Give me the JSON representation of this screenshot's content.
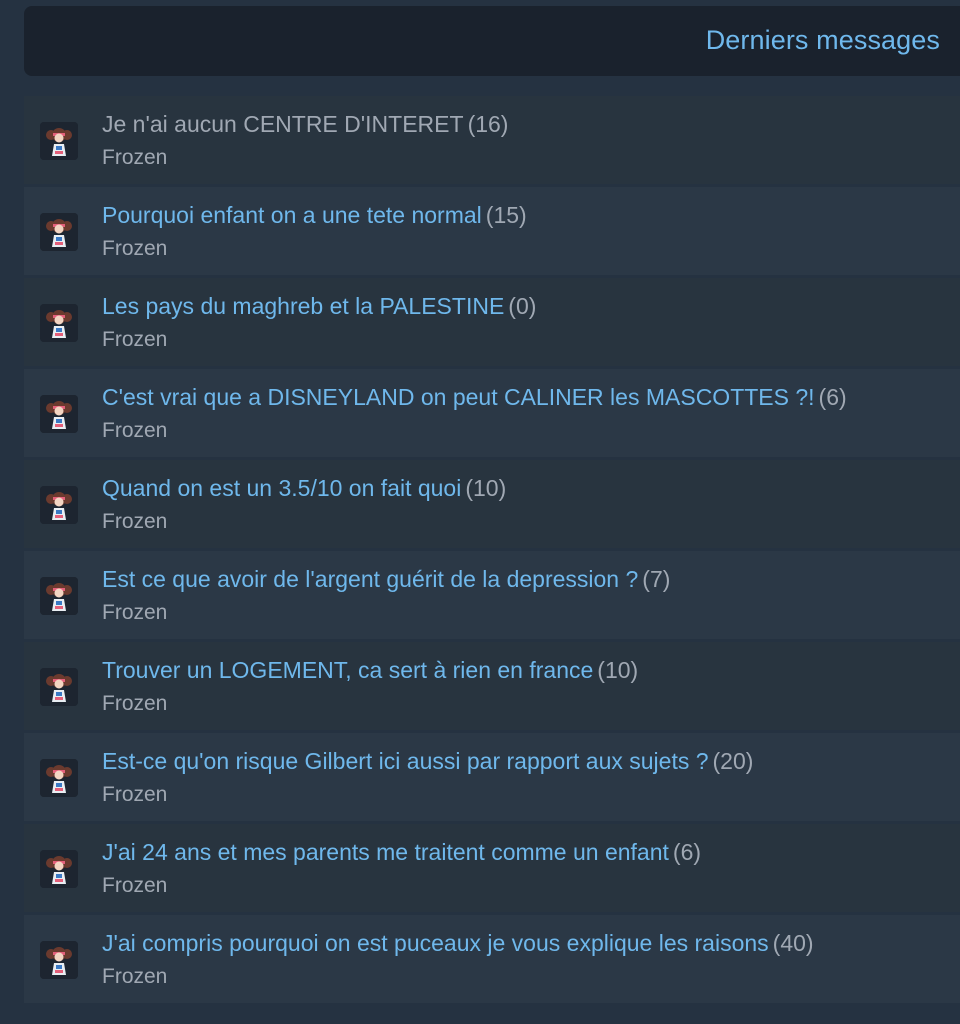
{
  "header": {
    "title": "Derniers messages"
  },
  "colors": {
    "background": "#253241",
    "header_bg": "#1a222d",
    "row_bg": "#2b3846",
    "link": "#6fb8ec",
    "muted": "#a0a8b3"
  },
  "topics": [
    {
      "title": "Je n'ai aucun CENTRE D'INTERET",
      "count": "(16)",
      "author": "Frozen",
      "avatar": "user-avatar-icon",
      "visited": true
    },
    {
      "title": "Pourquoi enfant on a une tete normal",
      "count": "(15)",
      "author": "Frozen",
      "avatar": "user-avatar-icon",
      "visited": false
    },
    {
      "title": "Les pays du maghreb et la PALESTINE",
      "count": "(0)",
      "author": "Frozen",
      "avatar": "user-avatar-icon",
      "visited": false
    },
    {
      "title": "C'est vrai que a DISNEYLAND on peut CALINER les MASCOTTES ?!",
      "count": "(6)",
      "author": "Frozen",
      "avatar": "user-avatar-icon",
      "visited": false
    },
    {
      "title": "Quand on est un 3.5/10 on fait quoi",
      "count": "(10)",
      "author": "Frozen",
      "avatar": "user-avatar-icon",
      "visited": false
    },
    {
      "title": "Est ce que avoir de l'argent guérit de la depression ?",
      "count": "(7)",
      "author": "Frozen",
      "avatar": "user-avatar-icon",
      "visited": false
    },
    {
      "title": "Trouver un LOGEMENT, ca sert à rien en france",
      "count": "(10)",
      "author": "Frozen",
      "avatar": "user-avatar-icon",
      "visited": false
    },
    {
      "title": "Est-ce qu'on risque Gilbert ici aussi par rapport aux sujets ?",
      "count": "(20)",
      "author": "Frozen",
      "avatar": "user-avatar-icon",
      "visited": false
    },
    {
      "title": "J'ai 24 ans et mes parents me traitent comme un enfant",
      "count": "(6)",
      "author": "Frozen",
      "avatar": "user-avatar-icon",
      "visited": false
    },
    {
      "title": "J'ai compris pourquoi on est puceaux je vous explique les raisons",
      "count": "(40)",
      "author": "Frozen",
      "avatar": "user-avatar-icon",
      "visited": false
    }
  ]
}
